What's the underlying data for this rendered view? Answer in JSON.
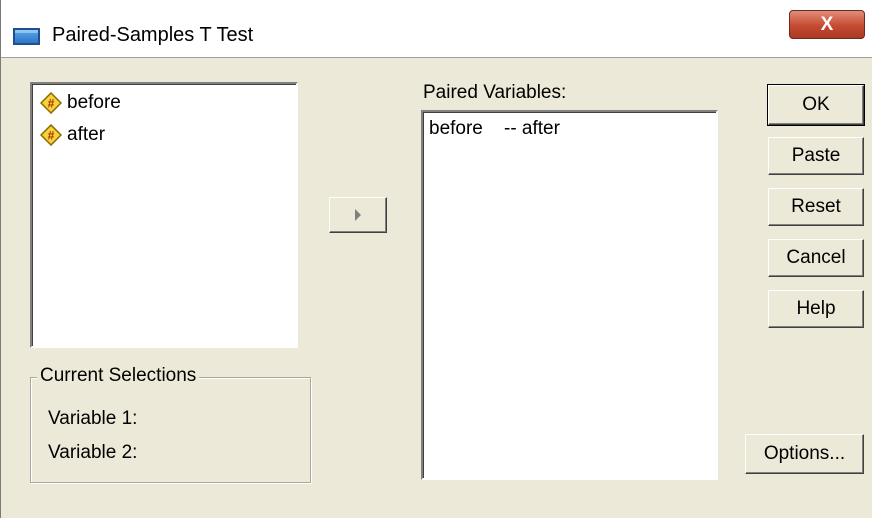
{
  "window": {
    "title": "Paired-Samples T Test",
    "close_label": "X"
  },
  "source_list": {
    "items": [
      {
        "label": "before",
        "icon": "numeric-variable-icon"
      },
      {
        "label": "after",
        "icon": "numeric-variable-icon"
      }
    ]
  },
  "paired": {
    "label": "Paired Variables:",
    "rows": [
      {
        "var1": "before",
        "var2": "-- after"
      }
    ]
  },
  "current_selections": {
    "title": "Current Selections",
    "variable1_label": "Variable 1:",
    "variable2_label": "Variable 2:"
  },
  "buttons": {
    "ok": "OK",
    "paste": "Paste",
    "reset": "Reset",
    "cancel": "Cancel",
    "help": "Help",
    "options": "Options..."
  }
}
